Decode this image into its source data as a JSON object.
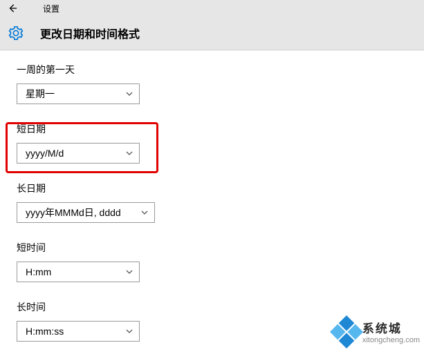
{
  "titlebar": {
    "title": "设置"
  },
  "header": {
    "title": "更改日期和时间格式"
  },
  "groups": {
    "first_day": {
      "label": "一周的第一天",
      "value": "星期一"
    },
    "short_date": {
      "label": "短日期",
      "value": "yyyy/M/d"
    },
    "long_date": {
      "label": "长日期",
      "value": "yyyy年MMMd日, dddd"
    },
    "short_time": {
      "label": "短时间",
      "value": "H:mm"
    },
    "long_time": {
      "label": "长时间",
      "value": "H:mm:ss"
    }
  },
  "watermark": {
    "line1": "系统城",
    "line2": "xitongcheng.com"
  }
}
